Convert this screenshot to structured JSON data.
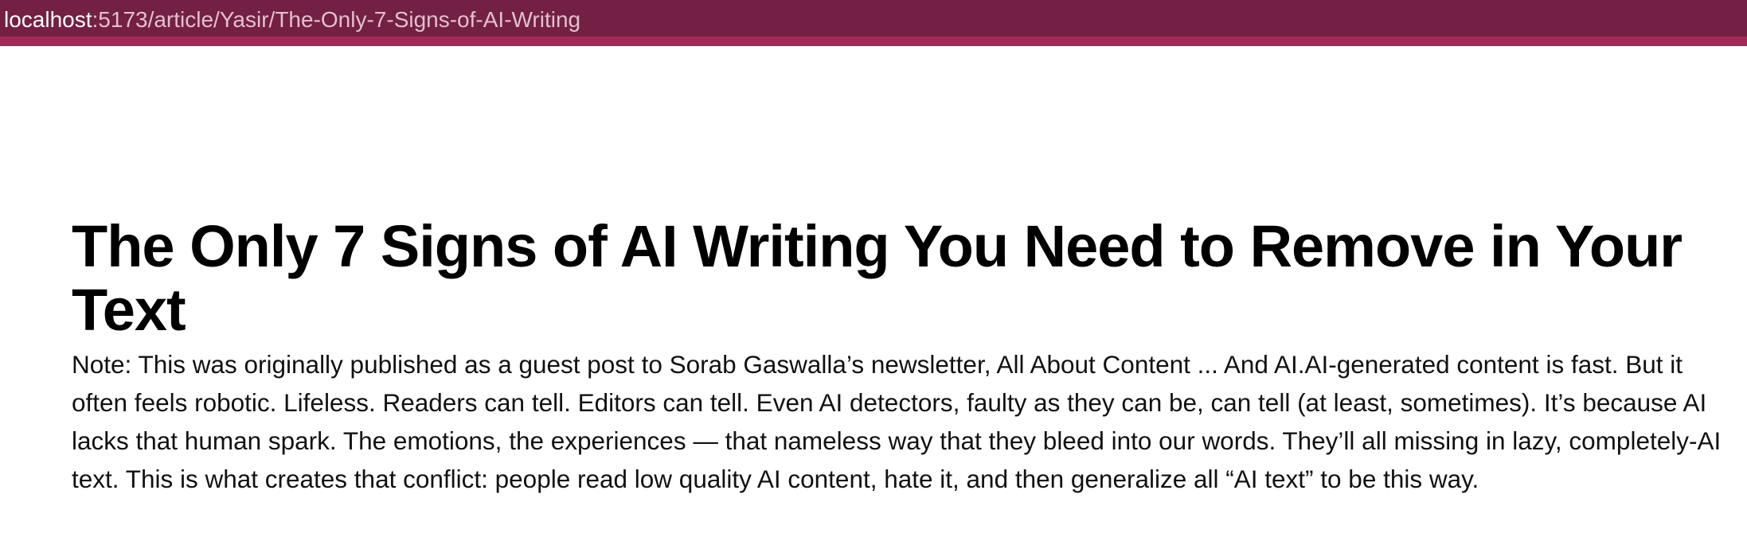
{
  "browser": {
    "url_host": "localhost",
    "url_path": ":5173/article/Yasir/The-Only-7-Signs-of-AI-Writing",
    "chrome_color": "#732044",
    "chrome_accent": "#a22a5a"
  },
  "article": {
    "title": "The Only 7 Signs of AI Writing You Need to Remove in Your Text",
    "body": "Note: This was originally published as a guest post to Sorab Gaswalla’s newsletter, All About Content ... And AI.AI-generated content is fast. But it often feels robotic. Lifeless. Readers can tell. Editors can tell. Even AI detectors, faulty as they can be, can tell (at least, sometimes). It’s because AI lacks that human spark. The emotions, the experiences — that nameless way that they bleed into our words. They’ll all missing in lazy, completely-AI text. This is what creates that conflict: people read low quality AI content, hate it, and then generalize all “AI text” to be this way."
  }
}
